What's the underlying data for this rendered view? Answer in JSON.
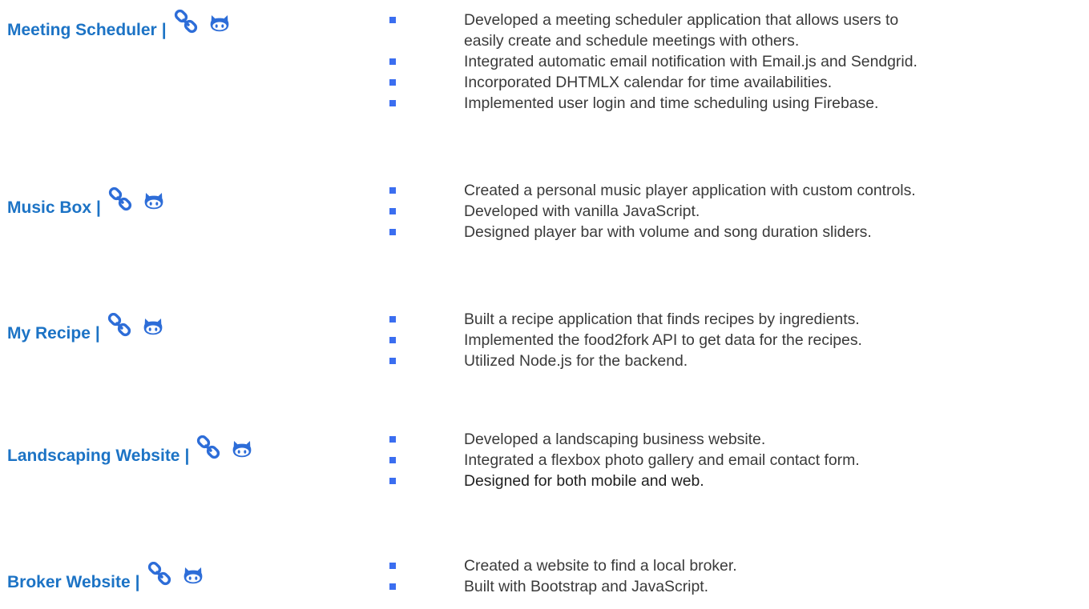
{
  "colors": {
    "title": "#1c73c5",
    "bullet": "#3b6ef0",
    "text": "#3a3a3a",
    "icon": "#2d6dd8"
  },
  "projects": [
    {
      "name": "Meeting Scheduler",
      "separator": "|",
      "icons": [
        "link-icon",
        "github-icon"
      ],
      "bullets": [
        "Developed a meeting scheduler application that allows users to",
        "Integrated automatic email notification with Email.js and Sendgrid.",
        "Incorporated DHTMLX calendar for time availabilities.",
        "Implemented user login and time scheduling using Firebase."
      ],
      "continuation": "easily create and schedule meetings with others."
    },
    {
      "name": "Music Box",
      "separator": "|",
      "icons": [
        "link-icon",
        "github-icon"
      ],
      "bullets": [
        "Created a personal music player application with custom controls.",
        "Developed with vanilla JavaScript.",
        "Designed player bar with volume and song duration sliders."
      ]
    },
    {
      "name": "My Recipe",
      "separator": "|",
      "icons": [
        "link-icon",
        "github-icon"
      ],
      "bullets": [
        "Built a recipe application that finds recipes by ingredients.",
        "Implemented the food2fork API to get data for the recipes.",
        "Utilized Node.js for the backend."
      ]
    },
    {
      "name": "Landscaping Website",
      "separator": "|",
      "icons": [
        "link-icon",
        "github-icon"
      ],
      "bullets": [
        "Developed a landscaping business website.",
        "Integrated a flexbox photo gallery and email contact form.",
        "Designed for both mobile and web."
      ]
    },
    {
      "name": "Broker Website",
      "separator": "|",
      "icons": [
        "link-icon",
        "github-icon"
      ],
      "bullets": [
        "Created a website to find a local broker.",
        "Built with Bootstrap and JavaScript."
      ]
    }
  ]
}
